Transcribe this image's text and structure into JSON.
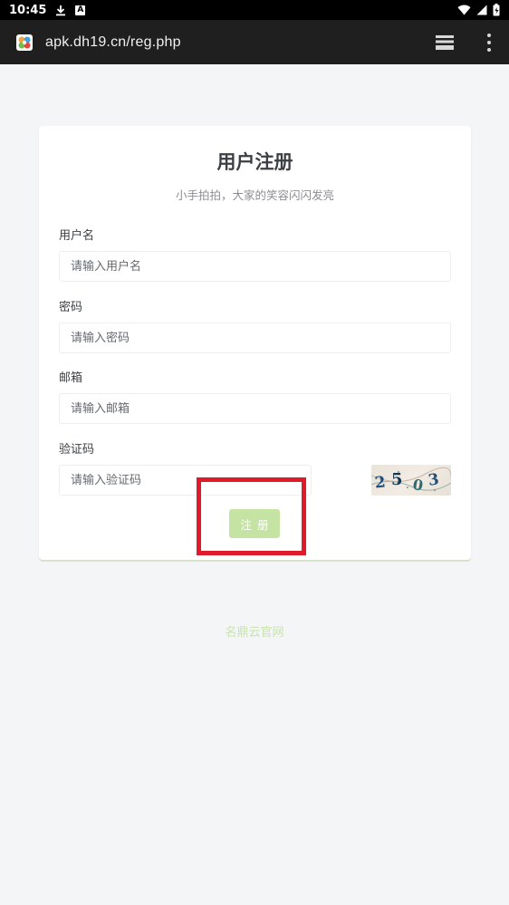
{
  "status_bar": {
    "time": "10:45",
    "notif_letter": "A"
  },
  "browser": {
    "url": "apk.dh19.cn/reg.php",
    "favicon": "app-favicon",
    "tabs_icon": "tabs-stack-icon",
    "menu_icon": "more-vert-icon"
  },
  "form": {
    "title": "用户注册",
    "subtitle": "小手拍拍，大家的笑容闪闪发亮",
    "fields": [
      {
        "label": "用户名",
        "placeholder": "请输入用户名"
      },
      {
        "label": "密码",
        "placeholder": "请输入密码"
      },
      {
        "label": "邮箱",
        "placeholder": "请输入邮箱"
      },
      {
        "label": "验证码",
        "placeholder": "请输入验证码"
      }
    ],
    "captcha_text": "25.03",
    "submit_label": "注册"
  },
  "footer": {
    "text": "名鼎云官网"
  },
  "colors": {
    "accent": "#c5e3a3",
    "highlight": "#e01a2a",
    "footer": "#c9e3ac"
  }
}
